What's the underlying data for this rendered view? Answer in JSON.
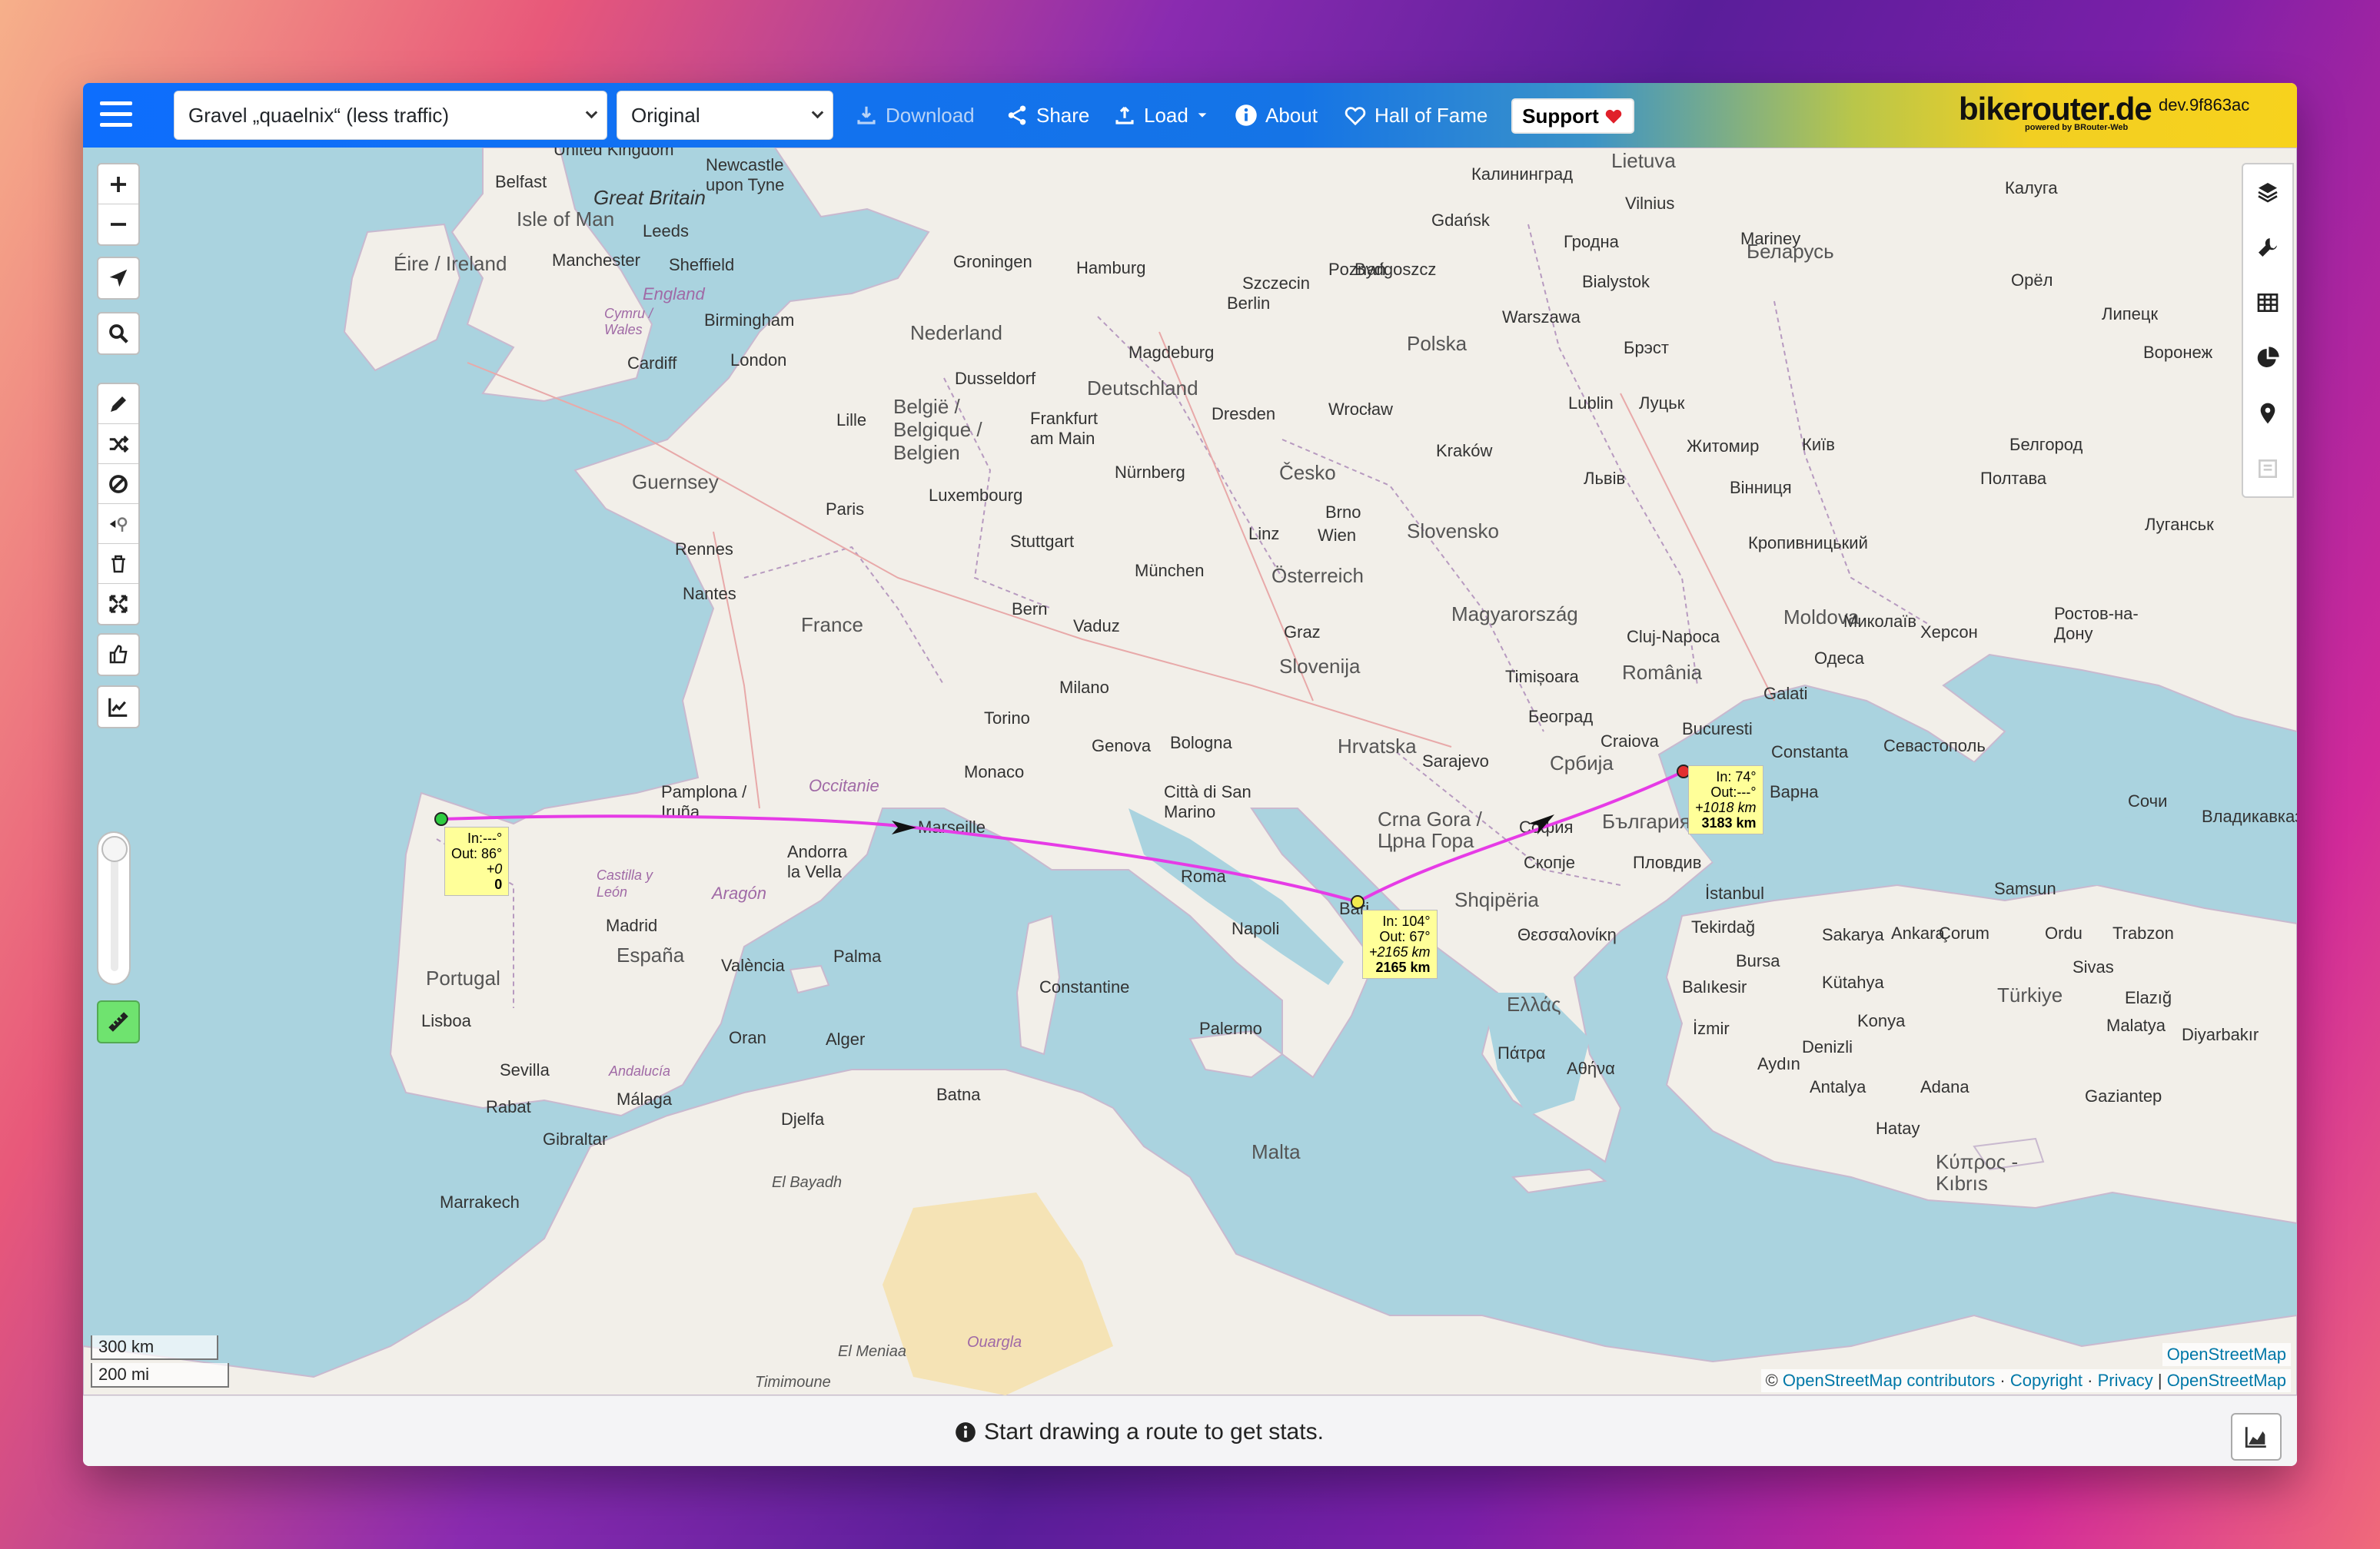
{
  "topbar": {
    "profile_select": "Gravel „quaelnix“ (less traffic)",
    "map_style_select": "Original",
    "download_label": "Download",
    "share_label": "Share",
    "load_label": "Load",
    "about_label": "About",
    "hall_of_fame_label": "Hall of Fame",
    "support_label": "Support",
    "brand": "bikerouter.de",
    "brand_sub": "powered by BRouter-Web",
    "version": "dev.9f863ac"
  },
  "map_labels": [
    {
      "text": "United Kingdom"
    },
    {
      "text": "Newcastle upon Tyne"
    },
    {
      "text": "Belfast"
    },
    {
      "text": "Great Britain"
    },
    {
      "text": "Isle of Man"
    },
    {
      "text": "Leeds"
    },
    {
      "text": "Éire / Ireland"
    },
    {
      "text": "Manchester"
    },
    {
      "text": "Sheffield"
    },
    {
      "text": "England"
    },
    {
      "text": "Cymru / Wales"
    },
    {
      "text": "Birmingham"
    },
    {
      "text": "Cardiff"
    },
    {
      "text": "London"
    },
    {
      "text": "Guernsey"
    },
    {
      "text": "Rennes"
    },
    {
      "text": "Nantes"
    },
    {
      "text": "Paris"
    },
    {
      "text": "France"
    },
    {
      "text": "Lille"
    },
    {
      "text": "Nederland"
    },
    {
      "text": "België / Belgique / Belgien"
    },
    {
      "text": "Luxembourg"
    },
    {
      "text": "Groningen"
    },
    {
      "text": "Hamburg"
    },
    {
      "text": "Berlin"
    },
    {
      "text": "Deutschland"
    },
    {
      "text": "Dusseldorf"
    },
    {
      "text": "Frankfurt am Main"
    },
    {
      "text": "Magdeburg"
    },
    {
      "text": "Dresden"
    },
    {
      "text": "Nürnberg"
    },
    {
      "text": "Stuttgart"
    },
    {
      "text": "München"
    },
    {
      "text": "Bern"
    },
    {
      "text": "Vaduz"
    },
    {
      "text": "Milano"
    },
    {
      "text": "Torino"
    },
    {
      "text": "Genova"
    },
    {
      "text": "Monaco"
    },
    {
      "text": "Bologna"
    },
    {
      "text": "Città di San Marino"
    },
    {
      "text": "Roma"
    },
    {
      "text": "Napoli"
    },
    {
      "text": "Palermo"
    },
    {
      "text": "Bari"
    },
    {
      "text": "Marseille"
    },
    {
      "text": "Occitanie"
    },
    {
      "text": "Pamplona / Iruña"
    },
    {
      "text": "Andorra la Vella"
    },
    {
      "text": "Madrid"
    },
    {
      "text": "España"
    },
    {
      "text": "València"
    },
    {
      "text": "Palma"
    },
    {
      "text": "Portugal"
    },
    {
      "text": "Lisboa"
    },
    {
      "text": "Sevilla"
    },
    {
      "text": "Málaga"
    },
    {
      "text": "Gibraltar"
    },
    {
      "text": "Castilla y León"
    },
    {
      "text": "Aragón"
    },
    {
      "text": "Andalucía"
    },
    {
      "text": "Szczecin"
    },
    {
      "text": "Poznań"
    },
    {
      "text": "Gdańsk"
    },
    {
      "text": "Bydgoszcz"
    },
    {
      "text": "Warszawa"
    },
    {
      "text": "Polska"
    },
    {
      "text": "Wrocław"
    },
    {
      "text": "Kraków"
    },
    {
      "text": "Lublin"
    },
    {
      "text": "Česko"
    },
    {
      "text": "Brno"
    },
    {
      "text": "Wien"
    },
    {
      "text": "Linz"
    },
    {
      "text": "Österreich"
    },
    {
      "text": "Graz"
    },
    {
      "text": "Slovensko"
    },
    {
      "text": "Magyarország"
    },
    {
      "text": "Slovenija"
    },
    {
      "text": "Hrvatska"
    },
    {
      "text": "Sarajevo"
    },
    {
      "text": "Србија"
    },
    {
      "text": "Београд"
    },
    {
      "text": "Timișoara"
    },
    {
      "text": "Cluj-Napoca"
    },
    {
      "text": "România"
    },
    {
      "text": "Bucuresti"
    },
    {
      "text": "Craiova"
    },
    {
      "text": "Constanta"
    },
    {
      "text": "Варна"
    },
    {
      "text": "България"
    },
    {
      "text": "София"
    },
    {
      "text": "Пловдив"
    },
    {
      "text": "Скопје"
    },
    {
      "text": "Crna Gora / Црна Гора"
    },
    {
      "text": "Shqipëria"
    },
    {
      "text": "Θεσσαλονίκη"
    },
    {
      "text": "Ελλάς"
    },
    {
      "text": "Πάτρα"
    },
    {
      "text": "Αθήνα"
    },
    {
      "text": "İstanbul"
    },
    {
      "text": "Tekirdağ"
    },
    {
      "text": "Bursa"
    },
    {
      "text": "Balıkesir"
    },
    {
      "text": "İzmir"
    },
    {
      "text": "Aydın"
    },
    {
      "text": "Denizli"
    },
    {
      "text": "Antalya"
    },
    {
      "text": "Konya"
    },
    {
      "text": "Ankara"
    },
    {
      "text": "Türkiye"
    },
    {
      "text": "Kütahya"
    },
    {
      "text": "Sakarya"
    },
    {
      "text": "Samsun"
    },
    {
      "text": "Malta"
    },
    {
      "text": "Constantine"
    },
    {
      "text": "Alger"
    },
    {
      "text": "Oran"
    },
    {
      "text": "Batna"
    },
    {
      "text": "Djelfa"
    },
    {
      "text": "Rabat"
    },
    {
      "text": "Marrakech"
    },
    {
      "text": "El Bayadh"
    },
    {
      "text": "Ouargla"
    },
    {
      "text": "El Meniaa"
    },
    {
      "text": "Timimoune"
    },
    {
      "text": "Moldova"
    },
    {
      "text": "Одеса"
    },
    {
      "text": "Миколаїв"
    },
    {
      "text": "Херсон"
    },
    {
      "text": "Київ"
    },
    {
      "text": "Житомир"
    },
    {
      "text": "Вінниця"
    },
    {
      "text": "Львів"
    },
    {
      "text": "Луцьк"
    },
    {
      "text": "Полтава"
    },
    {
      "text": "Кропивницький"
    },
    {
      "text": "Севастополь"
    },
    {
      "text": "Беларусь"
    },
    {
      "text": "Брэст"
    },
    {
      "text": "Гродна"
    },
    {
      "text": "Bialystok"
    },
    {
      "text": "Vilnius"
    },
    {
      "text": "Lietuva"
    },
    {
      "text": "Калининград"
    },
    {
      "text": "Калуга"
    },
    {
      "text": "Орёл"
    },
    {
      "text": "Липецк"
    },
    {
      "text": "Воронеж"
    },
    {
      "text": "Белгород"
    },
    {
      "text": "Луганськ"
    },
    {
      "text": "Ростов-на-Дону"
    },
    {
      "text": "Сочи"
    },
    {
      "text": "Владикавказ"
    },
    {
      "text": "Ordu"
    },
    {
      "text": "Trabzon"
    },
    {
      "text": "Sivas"
    },
    {
      "text": "Malatya"
    },
    {
      "text": "Elazığ"
    },
    {
      "text": "Diyarbakır"
    },
    {
      "text": "Adana"
    },
    {
      "text": "Gaziantep"
    },
    {
      "text": "Hatay"
    },
    {
      "text": "Κύπρος - Kıbrıs"
    },
    {
      "text": "Galati"
    },
    {
      "text": "Mariney"
    },
    {
      "text": "Çorum"
    }
  ],
  "route": {
    "start_tip": {
      "in": "In:---°",
      "out": "Out: 86°",
      "dist_seg": "+0",
      "dist_total": "0"
    },
    "mid_tip": {
      "in": "In: 104°",
      "out": "Out: 67°",
      "dist_seg": "+2165 km",
      "dist_total": "2165 km"
    },
    "end_tip": {
      "in": "In: 74°",
      "out": "Out:---°",
      "dist_seg": "+1018 km",
      "dist_total": "3183 km"
    },
    "colors": {
      "line": "#e63be6",
      "start": "#2ecc40",
      "mid": "#f2e94e",
      "end": "#e23030"
    }
  },
  "scale": {
    "km": "300 km",
    "mi": "200 mi"
  },
  "attribution": {
    "osm_top": "OpenStreetMap",
    "prefix": "©",
    "contributors": "OpenStreetMap contributors",
    "copyright": "Copyright",
    "privacy": "Privacy",
    "osm_bottom": "OpenStreetMap",
    "sep1": "·",
    "sep2": "·",
    "sep3": "|"
  },
  "footer": {
    "stats_text": "Start drawing a route to get stats."
  },
  "icons": {
    "accent": "#0d6efd",
    "brand_bg": "#f7d21d"
  }
}
